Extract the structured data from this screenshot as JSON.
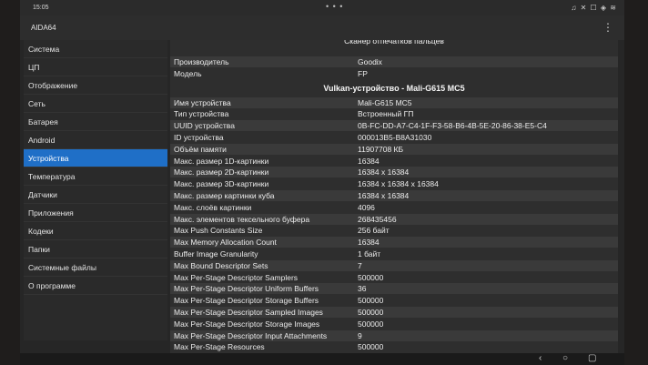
{
  "status": {
    "time": "15:05",
    "center_dots": "• • •",
    "icons": "♫ ✕ ☐ ◈ ≋"
  },
  "app": {
    "title": "AIDA64",
    "menu_icon": "⋮"
  },
  "sidebar": {
    "items": [
      {
        "label": "Система"
      },
      {
        "label": "ЦП"
      },
      {
        "label": "Отображение"
      },
      {
        "label": "Сеть"
      },
      {
        "label": "Батарея"
      },
      {
        "label": "Android"
      },
      {
        "label": "Устройства"
      },
      {
        "label": "Температура"
      },
      {
        "label": "Датчики"
      },
      {
        "label": "Приложения"
      },
      {
        "label": "Кодеки"
      },
      {
        "label": "Папки"
      },
      {
        "label": "Системные файлы"
      },
      {
        "label": "О программе"
      }
    ],
    "active_index": 6,
    "active_color": "#1f6fc7"
  },
  "content": {
    "top_section_partial": "Сканер отпечатков пальцев",
    "fingerprint_rows": [
      {
        "key": "Производитель",
        "value": "Goodix"
      },
      {
        "key": "Модель",
        "value": "FP"
      }
    ],
    "vulkan_section": "Vulkan-устройство - Mali-G615 MC5",
    "vulkan_rows": [
      {
        "key": "Имя устройства",
        "value": "Mali-G615 MC5"
      },
      {
        "key": "Тип устройства",
        "value": "Встроенный ГП"
      },
      {
        "key": "UUID устройства",
        "value": "0B-FC-DD-A7-C4-1F-F3-58-B6-4B-5E-20-86-38-E5-C4"
      },
      {
        "key": "ID устройства",
        "value": "000013B5-B8A31030"
      },
      {
        "key": "Объём памяти",
        "value": "11907708 КБ"
      },
      {
        "key": "Макс. размер 1D-картинки",
        "value": "16384"
      },
      {
        "key": "Макс. размер 2D-картинки",
        "value": "16384 x 16384"
      },
      {
        "key": "Макс. размер 3D-картинки",
        "value": "16384 x 16384 x 16384"
      },
      {
        "key": "Макс. размер картинки куба",
        "value": "16384 x 16384"
      },
      {
        "key": "Макс. слоёв картинки",
        "value": "4096"
      },
      {
        "key": "Макс. элементов тексельного буфера",
        "value": "268435456"
      },
      {
        "key": "Max Push Constants Size",
        "value": "256 байт"
      },
      {
        "key": "Max Memory Allocation Count",
        "value": "16384"
      },
      {
        "key": "Buffer Image Granularity",
        "value": "1 байт"
      },
      {
        "key": "Max Bound Descriptor Sets",
        "value": "7"
      },
      {
        "key": "Max Per-Stage Descriptor Samplers",
        "value": "500000"
      },
      {
        "key": "Max Per-Stage Descriptor Uniform Buffers",
        "value": "36"
      },
      {
        "key": "Max Per-Stage Descriptor Storage Buffers",
        "value": "500000"
      },
      {
        "key": "Max Per-Stage Descriptor Sampled Images",
        "value": "500000"
      },
      {
        "key": "Max Per-Stage Descriptor Storage Images",
        "value": "500000"
      },
      {
        "key": "Max Per-Stage Descriptor Input Attachments",
        "value": "9"
      },
      {
        "key": "Max Per-Stage Resources",
        "value": "500000"
      }
    ]
  },
  "navbar": {
    "back_icon": "‹",
    "home_icon": "○",
    "recents_icon": "▢"
  },
  "dock_colors": [
    "#e6e6e6",
    "#3b7be0",
    "#f2f2f2",
    "#2fa0e8",
    "#d22c2c",
    "#e8e8e8",
    "#9a9a9a",
    "#7a7a7a"
  ]
}
